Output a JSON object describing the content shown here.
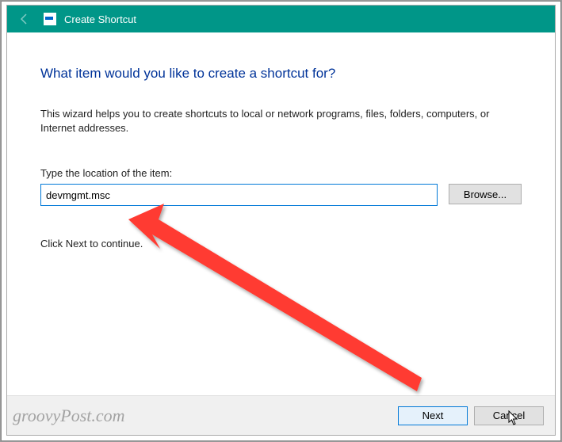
{
  "titlebar": {
    "title": "Create Shortcut"
  },
  "content": {
    "heading": "What item would you like to create a shortcut for?",
    "description": "This wizard helps you to create shortcuts to local or network programs, files, folders, computers, or Internet addresses.",
    "field_label": "Type the location of the item:",
    "location_value": "devmgmt.msc",
    "browse_label": "Browse...",
    "continue_text": "Click Next to continue."
  },
  "footer": {
    "next_label": "Next",
    "cancel_label": "Cancel"
  },
  "watermark": "groovyPost.com",
  "colors": {
    "titlebar_bg": "#009688",
    "heading_color": "#003399",
    "primary_border": "#0078d7",
    "arrow_color": "#ff3b30"
  }
}
